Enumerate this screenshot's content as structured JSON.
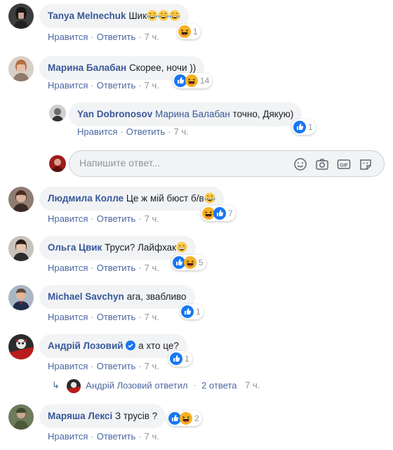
{
  "colors": {
    "link": "#385898",
    "muted": "#90949c",
    "bubble": "#f2f3f5",
    "like": "#1877f2",
    "haha": "#f7b125"
  },
  "action_labels": {
    "like": "Нравится",
    "reply": "Ответить",
    "separator": "·"
  },
  "comments": [
    {
      "author": "Tanya Melnechuk",
      "text": "Шик",
      "emojis": [
        "haha-emoji",
        "haha-emoji",
        "haha-emoji"
      ],
      "time": "7 ч.",
      "reactions": [
        "haha"
      ],
      "reaction_count": "1"
    },
    {
      "author": "Марина Балабан",
      "text": "Скорее, ночи ))",
      "time": "7 ч.",
      "reactions": [
        "like",
        "haha"
      ],
      "reaction_count": "14"
    },
    {
      "author": "Yan Dobronosov",
      "mention": "Марина Балабан",
      "text": "точно, Дякую)",
      "time": "7 ч.",
      "reactions": [
        "like"
      ],
      "reaction_count": "1"
    },
    {
      "author": "Людмила Колле",
      "text": "Це ж мій бюст б/в",
      "emojis": [
        "haha-emoji"
      ],
      "time": "7 ч.",
      "reactions": [
        "haha",
        "like"
      ],
      "reaction_count": "7"
    },
    {
      "author": "Ольга Цвик",
      "text": "Труси? Лайфхак",
      "emojis": [
        "grin-emoji"
      ],
      "time": "7 ч.",
      "reactions": [
        "like",
        "haha"
      ],
      "reaction_count": "5"
    },
    {
      "author": "Michael Savchyn",
      "text": "ага, звабливо",
      "time": "7 ч.",
      "reactions": [
        "like"
      ],
      "reaction_count": "1"
    },
    {
      "author": "Андрій Лозовий",
      "verified": true,
      "text": "а хто це?",
      "time": "7 ч.",
      "reactions": [
        "like"
      ],
      "reaction_count": "1"
    },
    {
      "author": "Маряша Лексі",
      "text": "З трусів ?",
      "time": "7 ч.",
      "reactions": [
        "like",
        "haha"
      ],
      "reaction_count": "2"
    }
  ],
  "reply_box": {
    "placeholder": "Напишите ответ..."
  },
  "replies_summary": {
    "author": "Андрій Лозовий",
    "verb": "ответил",
    "count_label": "2 ответа",
    "time": "7 ч."
  }
}
